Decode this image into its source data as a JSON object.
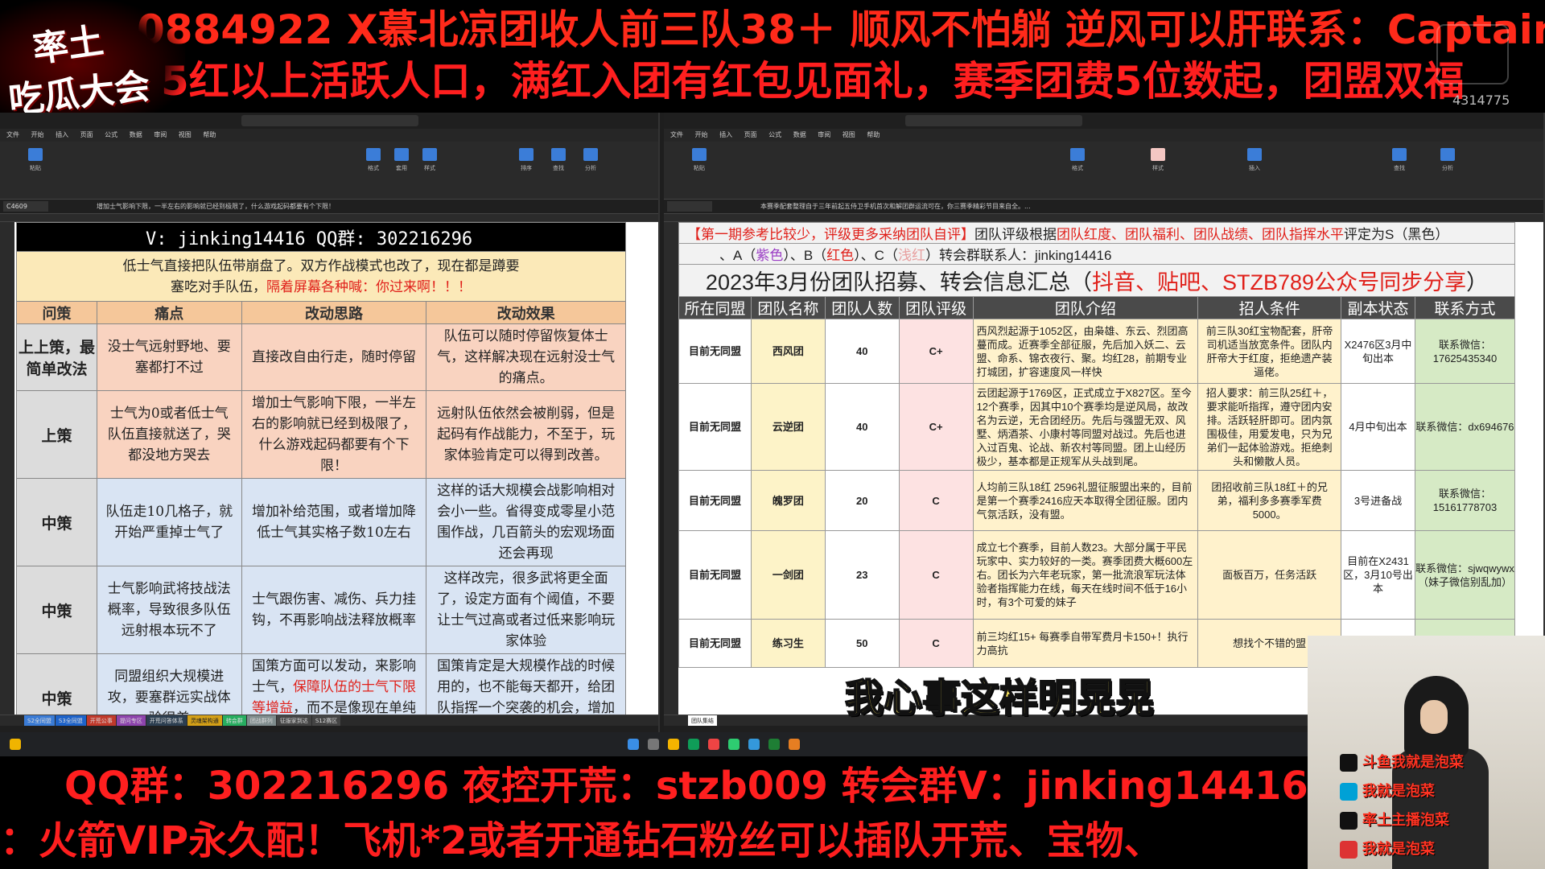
{
  "banners": {
    "top_line1": "0884922    X慕北凉团收人前三队38＋ 顺风不怕躺 逆风可以肝联系：Captain.",
    "top_line2": "5红以上活跃人口，满红入团有红包见面礼，赛季团费5位数起，团盟双福",
    "bottom_line1": "QQ群：302216296    夜控开荒：stzb009  转会群V：jinking14416",
    "bottom_line2": "：火箭VIP永久配！飞机*2或者开通钻石粉丝可以插队开荒、宝物、"
  },
  "logo": {
    "line1": "率土",
    "line2": "吃瓜大会"
  },
  "douyu": {
    "viewer_count": "4314775"
  },
  "subtitle": "我心事这样明晃晃",
  "left_sheet": {
    "cell_ref": "C4609",
    "formula": "增加士气影响下限，一半左右的影响就已经到极限了，什么游戏起码都要有个下限！",
    "header_contact": "V: jinking14416 QQ群: 302216296",
    "note_line1": "低士气直接把队伍带崩盘了。双方作战模式也改了，现在都是蹲要",
    "note_line2_black": "塞吃对手队伍，",
    "note_line2_red": "隔着屏幕各种喊：你过来啊！！！",
    "columns": [
      "问策",
      "痛点",
      "改动思路",
      "改动效果"
    ],
    "rows": [
      {
        "level": "上上策，最简单改法",
        "pain": "没士气远射野地、要塞都打不过",
        "idea": "直接改自由行走，随时停留",
        "effect": "队伍可以随时停留恢复体士气，这样解决现在远射没士气的痛点。"
      },
      {
        "level": "上策",
        "pain": "士气为0或者低士气队伍直接就送了，哭都没地方哭去",
        "idea": "增加士气影响下限，一半左右的影响就已经到极限了，什么游戏起码都要有个下限！",
        "effect": "远射队伍依然会被削弱，但是起码有作战能力，不至于，玩家体验肯定可以得到改善。"
      },
      {
        "level": "中策",
        "pain": "队伍走10几格子，就开始严重掉士气了",
        "idea": "增加补给范围，或者增加降低士气其实格子数10左右",
        "effect": "这样的话大规模会战影响相对会小一些。省得变成零星小范围作战，几百箭头的宏观场面还会再现"
      },
      {
        "level": "中策",
        "pain": "士气影响武将技战法概率，导致很多队伍远射根本玩不了",
        "idea": "士气跟伤害、减伤、兵力挂钩，不再影响战法释放概率",
        "effect": "这样改完，很多武将更全面了，设定方面有个阈值，不要让士气过高或者过低来影响玩家体验"
      },
      {
        "level": "中策",
        "pain": "同盟组织大规模进攻，要塞群远实战体验很差",
        "idea_black": "国策方面可以发动，来影响士气，",
        "idea_red": "保障队伍的士气下限等增益",
        "idea_tail": "，而不是像现在单纯加士气点",
        "effect": "国策肯定是大规模作战的时候用的，也不能每天都开，给团队指挥一个突袭的机会，增加战斗的变数"
      }
    ],
    "tabs": [
      "S2全同盟",
      "S3全同盟",
      "开荒公事",
      "提问专区",
      "开荒问答体系",
      "灵魂架构通",
      "转会群",
      "团战群列",
      "征服家到达",
      "S12赛区"
    ]
  },
  "right_sheet": {
    "cell_ref": "",
    "formula": "本赛季配套整理自于三年前起五侍卫手机首次和解团群运流可在，你三赛季精彩节目来自全。...",
    "top_line1_bracket": "【第一期参考比较少，评级更多采纳团队自评】",
    "top_line1_text": "团队评级根据",
    "top_line1_criteria": "团队红度、团队福利、团队战绩、团队指挥水平",
    "top_line1_tail": "评定为S（黑色）",
    "top_line2": {
      "a": "、A（",
      "a_color": "紫色",
      "b": "）、B（",
      "b_color": "红色",
      "c": "）、C（",
      "c_color": "浅红",
      "tail": "）转会群联系人：jinking14416"
    },
    "title_black": "2023年3月份团队招募、转会信息汇总（",
    "title_red": "抖音、贴吧、STZB789公众号同步分享",
    "title_end": "）",
    "columns": [
      "所在同盟",
      "团队名称",
      "团队人数",
      "团队评级",
      "团队介绍",
      "招人条件",
      "副本状态",
      "联系方式"
    ],
    "rows": [
      {
        "alliance": "目前无同盟",
        "name": "西风团",
        "size": "40",
        "rating": "C+",
        "intro": "西风烈起源于1052区，由枭雄、东云、烈团高蔓而成。近赛季全部征服，先后加入妖二、云盟、命系、锦衣夜行、聚。均红28，前期专业打城团，扩容速度风一样快",
        "req": "前三队30红宝物配套，肝帝司机适当放宽条件。团队内肝帝大于红度，拒绝遗产装逼佬。",
        "status": "X2476区3月中旬出本",
        "contact": "联系微信：17625435340"
      },
      {
        "alliance": "目前无同盟",
        "name": "云逆团",
        "size": "40",
        "rating": "C+",
        "intro": "云团起源于1769区，正式成立于X827区。至今12个赛季，因其中10个赛季均是逆风局，故改名为云逆，无合团经历。先后与强盟无双、风墅、炳酒茶、小康村等同盟对战过。先后也进入过百鬼、论战、新农村等同盟。团上山经历极少，基本都是正规军从头战到尾。",
        "req": "招人要求：前三队25红＋，要求能听指挥，遵守团内安排。活跃轻肝即可。团内氛围极佳，用爱发电，只为兄弟们一起体验游戏。拒绝刺头和懒散人员。",
        "status": "4月中旬出本",
        "contact": "联系微信：dx694676"
      },
      {
        "alliance": "目前无同盟",
        "name": "魄罗团",
        "size": "20",
        "rating": "C",
        "intro": "人均前三队18红\n2596礼盟征服盟出来的，目前是第一个赛季2416应天本取得全团征服。团内气氛活跃，没有盟。",
        "req": "团招收前三队18红＋的兄弟，福利多多赛季军费5000。",
        "status": "3号进备战",
        "contact": "联系微信：15161778703"
      },
      {
        "alliance": "目前无同盟",
        "name": "一剑团",
        "size": "23",
        "rating": "C",
        "intro": "成立七个赛季，目前人数23。大部分属于平民玩家中、实力较好的一类。赛季团费大概600左右。团长为六年老玩家，第一批流浪军玩法体验者指挥能力在线，每天在线时间不低于16小时，有3个可爱的妹子",
        "req": "面板百万，任务活跃",
        "status": "目前在X2431区，3月10号出本",
        "contact": "联系微信：sjwqwywx（妹子微信别乱加）"
      },
      {
        "alliance": "目前无同盟",
        "name": "练习生",
        "size": "50",
        "rating": "C",
        "intro": "前三均红15+\n每赛季自带军费月卡150+！执行力高抗",
        "req": "想找个不错的盟",
        "status": "",
        "contact": ""
      }
    ],
    "tab": "团队集结"
  },
  "cam_overlay": [
    {
      "platform": "大神",
      "text": "斗鱼我就是泡菜"
    },
    {
      "platform": "bilibili",
      "text": "我就是泡菜"
    },
    {
      "platform": "抖音",
      "text": "率土主播泡菜"
    },
    {
      "platform": "头条",
      "text": "我就是泡菜"
    }
  ],
  "colors": {
    "banner_red": "#ff1f1f",
    "subtitle_yellow": "#ffe95e",
    "header_orange": "#f5c79a",
    "note_yellow": "#fbe9b8"
  }
}
